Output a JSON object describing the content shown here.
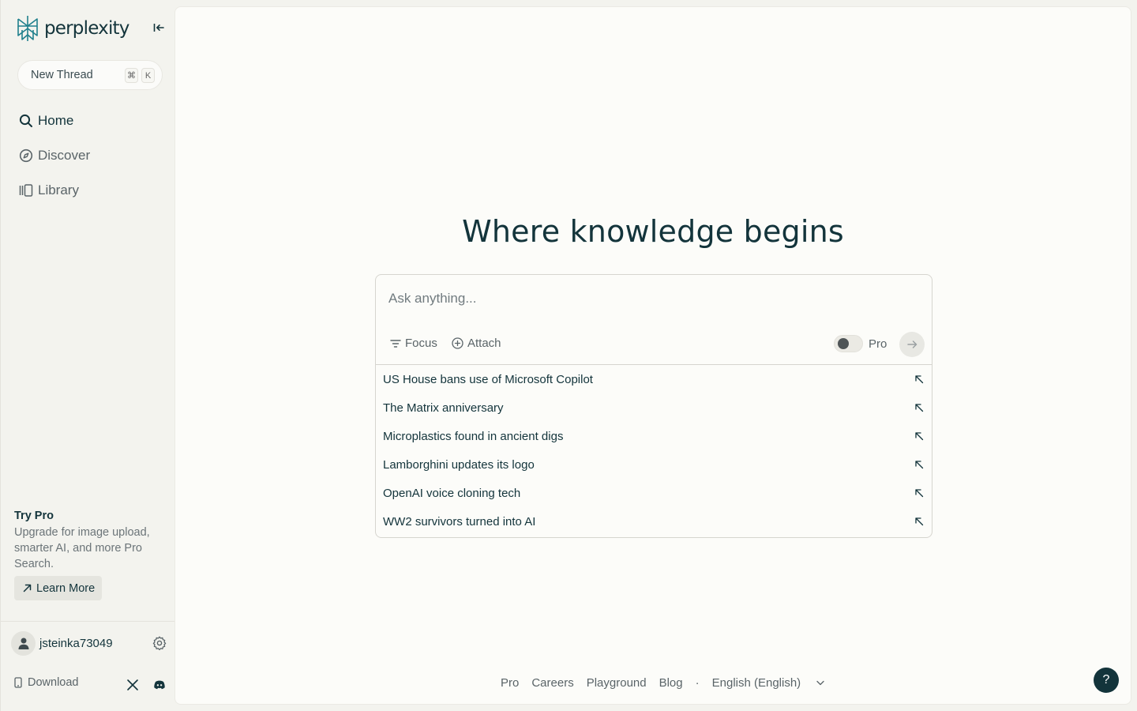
{
  "brand": {
    "name": "perplexity",
    "accent": "#20808d",
    "dark": "#13343b"
  },
  "sidebar": {
    "new_thread": {
      "label": "New Thread",
      "shortcut": [
        "⌘",
        "K"
      ]
    },
    "nav": [
      {
        "label": "Home",
        "icon": "search-icon",
        "active": true
      },
      {
        "label": "Discover",
        "icon": "compass-icon",
        "active": false
      },
      {
        "label": "Library",
        "icon": "library-icon",
        "active": false
      }
    ],
    "try_pro": {
      "title": "Try Pro",
      "description": "Upgrade for image upload, smarter AI, and more Pro Search.",
      "button": "Learn More"
    },
    "user": {
      "username": "jsteinka73049"
    },
    "download_label": "Download"
  },
  "main": {
    "headline": "Where knowledge begins",
    "search": {
      "placeholder": "Ask anything...",
      "focus_label": "Focus",
      "attach_label": "Attach",
      "pro_label": "Pro",
      "pro_enabled": false
    },
    "suggestions": [
      "US House bans use of Microsoft Copilot",
      "The Matrix anniversary",
      "Microplastics found in ancient digs",
      "Lamborghini updates its logo",
      "OpenAI voice cloning tech",
      "WW2 survivors turned into AI"
    ],
    "footer": {
      "links": [
        "Pro",
        "Careers",
        "Playground",
        "Blog"
      ],
      "separator": "·",
      "language": "English (English)"
    },
    "help_label": "?"
  }
}
